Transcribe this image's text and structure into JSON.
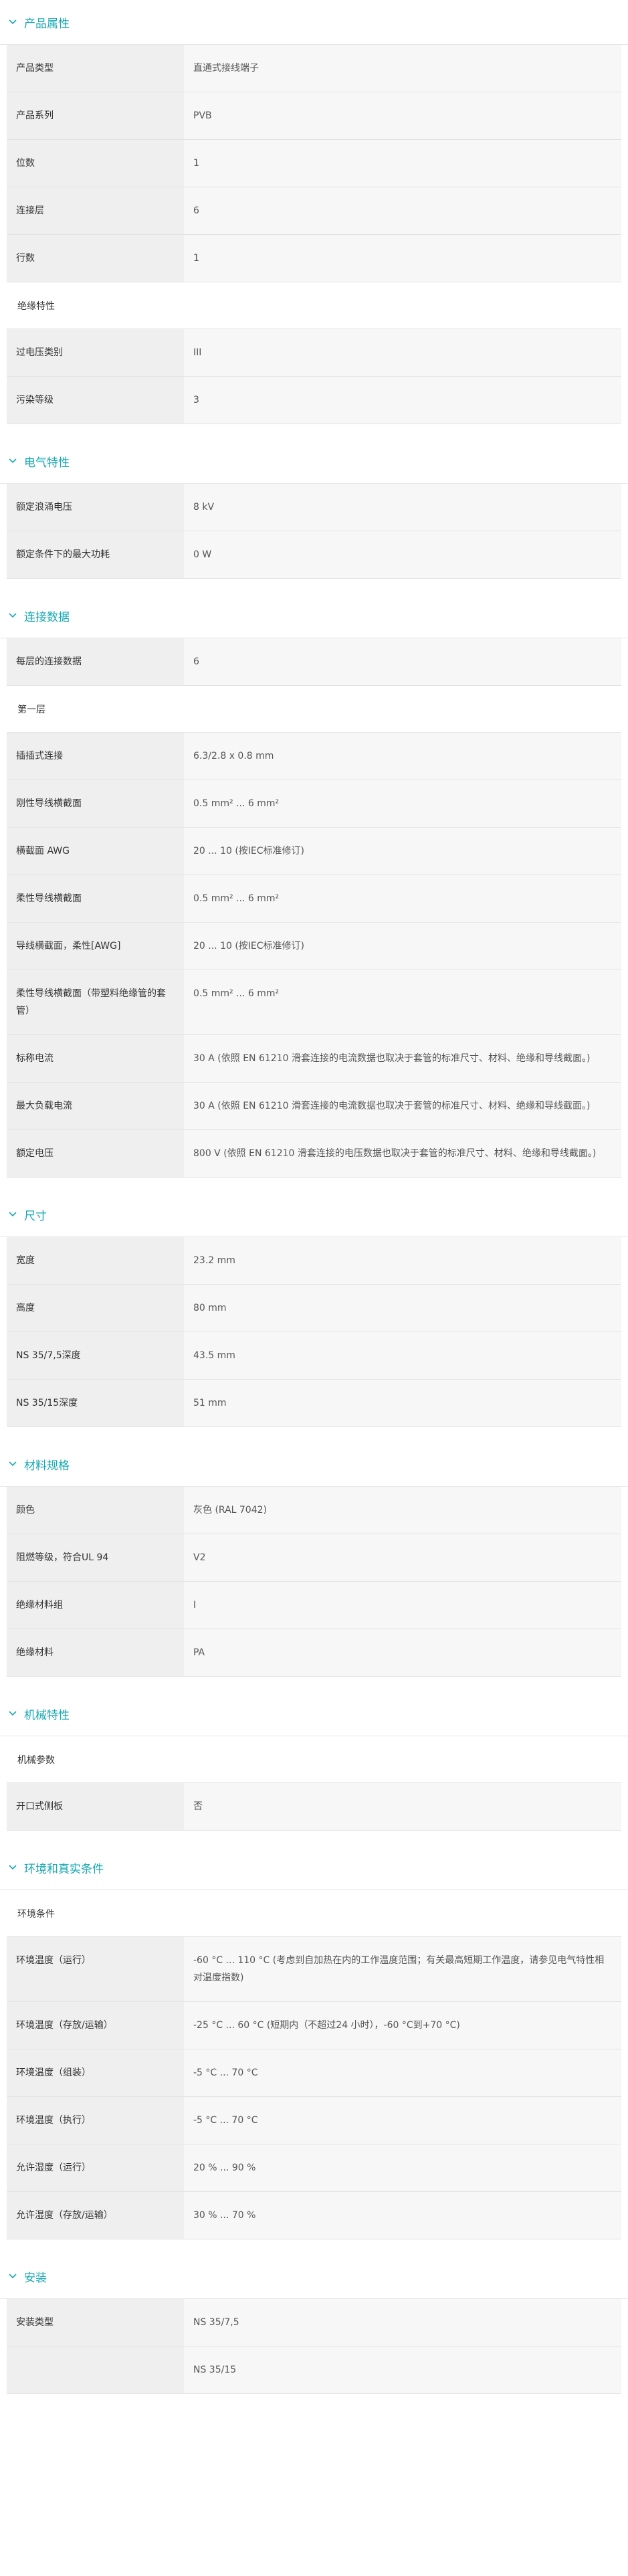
{
  "accent_color": "#15a8b4",
  "sections": [
    {
      "title": "产品属性",
      "rows": [
        {
          "label": "产品类型",
          "value": "直通式接线端子"
        },
        {
          "label": "产品系列",
          "value": "PVB"
        },
        {
          "label": "位数",
          "value": "1"
        },
        {
          "label": "连接层",
          "value": "6"
        },
        {
          "label": "行数",
          "value": "1"
        },
        {
          "subhead": "绝缘特性"
        },
        {
          "label": "过电压类别",
          "value": "III"
        },
        {
          "label": "污染等级",
          "value": "3"
        }
      ]
    },
    {
      "title": "电气特性",
      "rows": [
        {
          "label": "额定浪涌电压",
          "value": "8 kV"
        },
        {
          "label": "额定条件下的最大功耗",
          "value": "0 W"
        }
      ]
    },
    {
      "title": "连接数据",
      "rows": [
        {
          "label": "每层的连接数据",
          "value": "6"
        },
        {
          "subhead": "第一层"
        },
        {
          "label": "插插式连接",
          "value": "6.3/2.8 x 0.8 mm"
        },
        {
          "label": "刚性导线横截面",
          "value": "0.5 mm² ... 6 mm²"
        },
        {
          "label": "横截面 AWG",
          "value": "20 ... 10 (按IEC标准修订)"
        },
        {
          "label": "柔性导线横截面",
          "value": "0.5 mm² ... 6 mm²"
        },
        {
          "label": "导线横截面，柔性[AWG]",
          "value": "20 ... 10 (按IEC标准修订)"
        },
        {
          "label": "柔性导线横截面（带塑料绝缘管的套管）",
          "value": "0.5 mm² ... 6 mm²"
        },
        {
          "label": "标称电流",
          "value": "30 A (依照 EN 61210 滑套连接的电流数据也取决于套管的标准尺寸、材料、绝缘和导线截面。)"
        },
        {
          "label": "最大负载电流",
          "value": "30 A (依照 EN 61210 滑套连接的电流数据也取决于套管的标准尺寸、材料、绝缘和导线截面。)"
        },
        {
          "label": "额定电压",
          "value": "800 V (依照 EN 61210 滑套连接的电压数据也取决于套管的标准尺寸、材料、绝缘和导线截面。)"
        }
      ]
    },
    {
      "title": "尺寸",
      "rows": [
        {
          "label": "宽度",
          "value": "23.2 mm"
        },
        {
          "label": "高度",
          "value": "80 mm"
        },
        {
          "label": "NS 35/7,5深度",
          "value": "43.5 mm"
        },
        {
          "label": "NS 35/15深度",
          "value": "51 mm"
        }
      ]
    },
    {
      "title": "材料规格",
      "rows": [
        {
          "label": "颜色",
          "value": "灰色 (RAL 7042)"
        },
        {
          "label": "阻燃等级，符合UL 94",
          "value": "V2"
        },
        {
          "label": "绝缘材料组",
          "value": "I"
        },
        {
          "label": "绝缘材料",
          "value": "PA"
        }
      ]
    },
    {
      "title": "机械特性",
      "rows": [
        {
          "subhead": "机械参数"
        },
        {
          "label": "开口式侧板",
          "value": "否"
        }
      ]
    },
    {
      "title": "环境和真实条件",
      "rows": [
        {
          "subhead": "环境条件"
        },
        {
          "label": "环境温度（运行）",
          "value": "-60 °C ... 110 °C (考虑到自加热在内的工作温度范围；有关最高短期工作温度，请参见电气特性相对温度指数)"
        },
        {
          "label": "环境温度（存放/运输）",
          "value": "-25 °C ... 60 °C (短期内（不超过24 小时），-60 °C到+70 °C)"
        },
        {
          "label": "环境温度（组装）",
          "value": "-5 °C ... 70 °C"
        },
        {
          "label": "环境温度（执行）",
          "value": "-5 °C ... 70 °C"
        },
        {
          "label": "允许湿度（运行）",
          "value": "20 % ... 90 %"
        },
        {
          "label": "允许湿度（存放/运输）",
          "value": "30 % ... 70 %"
        }
      ]
    },
    {
      "title": "安装",
      "rows": [
        {
          "label": "安装类型",
          "value": "NS 35/7,5"
        },
        {
          "label": "",
          "value": "NS 35/15"
        }
      ]
    }
  ]
}
